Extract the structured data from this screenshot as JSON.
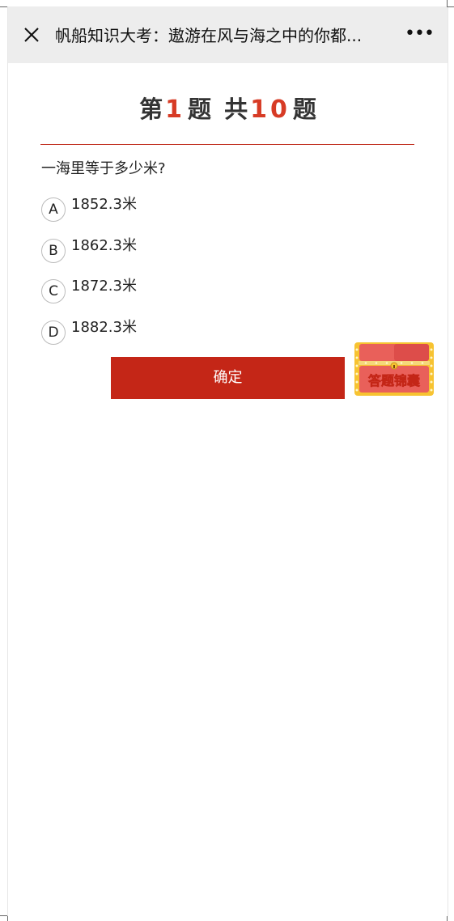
{
  "topbar": {
    "title": "帆船知识大考：遨游在风与海之中的你都...",
    "more_label": "•••"
  },
  "quiz": {
    "heading_prefix": "第",
    "current": "1",
    "heading_mid": "题",
    "heading_total_prefix": "共",
    "total": "10",
    "heading_suffix": "题",
    "question": "一海里等于多少米?",
    "options": [
      {
        "letter": "A",
        "text": "1852.3米"
      },
      {
        "letter": "B",
        "text": "1862.3米"
      },
      {
        "letter": "C",
        "text": "1872.3米"
      },
      {
        "letter": "D",
        "text": "1882.3米"
      }
    ],
    "confirm_label": "确定"
  },
  "treasure": {
    "label": "答题锦囊"
  },
  "colors": {
    "accent": "#c42617",
    "number_red": "#d73b25",
    "topbar_bg": "#ededed"
  }
}
